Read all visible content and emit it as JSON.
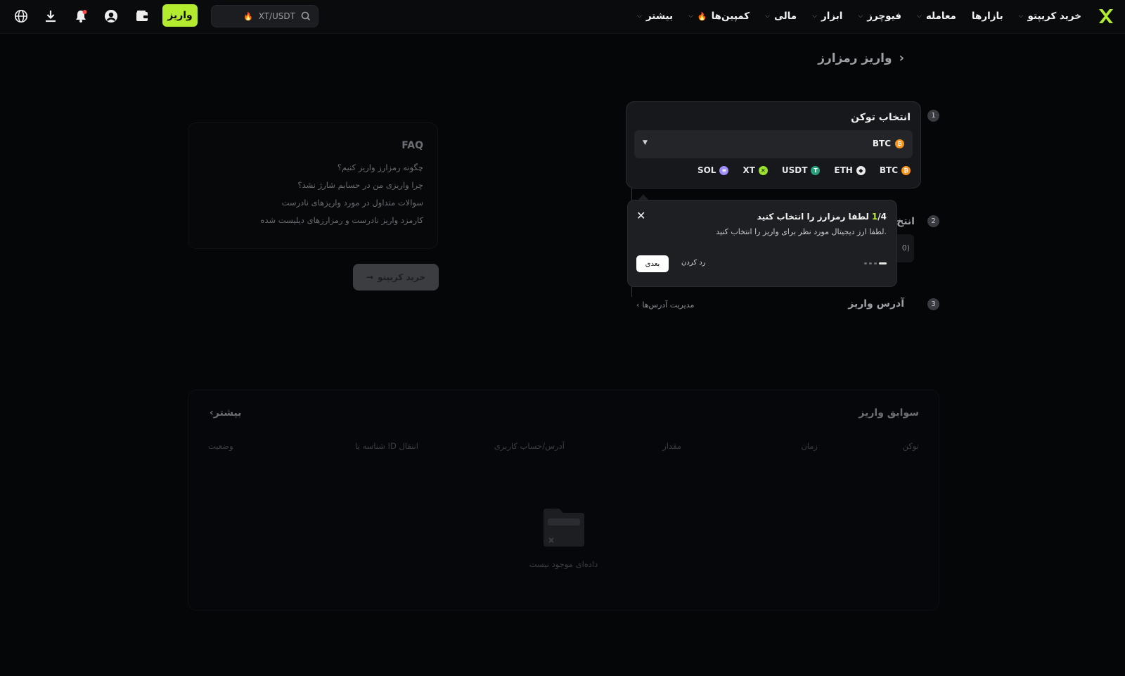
{
  "topbar": {
    "nav": [
      {
        "label": "خرید کریپتو",
        "has_chevron": true,
        "hot": false
      },
      {
        "label": "بازارها",
        "has_chevron": false,
        "hot": false
      },
      {
        "label": "معامله",
        "has_chevron": true,
        "hot": false
      },
      {
        "label": "فیوچرز",
        "has_chevron": true,
        "hot": false
      },
      {
        "label": "ابزار",
        "has_chevron": true,
        "hot": false
      },
      {
        "label": "مالی",
        "has_chevron": true,
        "hot": false
      },
      {
        "label": "کمپین‌ها",
        "has_chevron": true,
        "hot": true
      },
      {
        "label": "بیشتر",
        "has_chevron": true,
        "hot": false
      }
    ],
    "search_text": "XT/USDT",
    "deposit_label": "واریز",
    "icons": [
      "wallet-icon",
      "profile-icon",
      "notification-icon",
      "download-icon",
      "language-icon"
    ],
    "brand_color": "#b3ec2e"
  },
  "page": {
    "title": "واریز رمزارز"
  },
  "steps": {
    "one": {
      "num": "1",
      "title": "انتخاب توکن"
    },
    "two": {
      "num": "2",
      "title": "انتخ"
    },
    "three": {
      "num": "3",
      "title": "آدرس واریز"
    }
  },
  "token_select": {
    "selected": "BTC",
    "quick": [
      {
        "symbol": "BTC",
        "color": "#f7931a",
        "glyph": "₿"
      },
      {
        "symbol": "ETH",
        "color": "#e8e8ea",
        "glyph": "◆"
      },
      {
        "symbol": "USDT",
        "color": "#26a17b",
        "glyph": "T"
      },
      {
        "symbol": "XT",
        "color": "#9be22d",
        "glyph": "✕"
      },
      {
        "symbol": "SOL",
        "color": "#9e8cff",
        "glyph": "≡"
      }
    ]
  },
  "step2_partial": "0)",
  "manage_addresses": "مدیریت آدرس‌ها",
  "popover": {
    "step_current": "1",
    "step_total": "/4",
    "title": "لطفا رمزارز را انتخاب کنید",
    "description": "لطفا ارز دیجیتال مورد نظر برای واریز را انتخاب کنید.",
    "next_label": "بعدی",
    "cancel_label": "رد کردن"
  },
  "faq": {
    "title": "FAQ",
    "items": [
      "چگونه رمزارز واریز کنیم؟",
      "چرا واریزی من در حسابم شارژ نشد؟",
      "سوالات متداول در مورد واریزهای نادرست",
      "کارمزد واریز نادرست و رمزارزهای دیلیست شده"
    ]
  },
  "buy_crypto": "خرید کریپتو",
  "history": {
    "title": "سوابق واریز",
    "more": "بیشتر",
    "columns": [
      "توکن",
      "زمان",
      "مقدار",
      "آدرس/حساب کاربری",
      "شناسه یا ID انتقال",
      "وضعیت"
    ],
    "empty": "داده‌ای موجود نیست"
  }
}
